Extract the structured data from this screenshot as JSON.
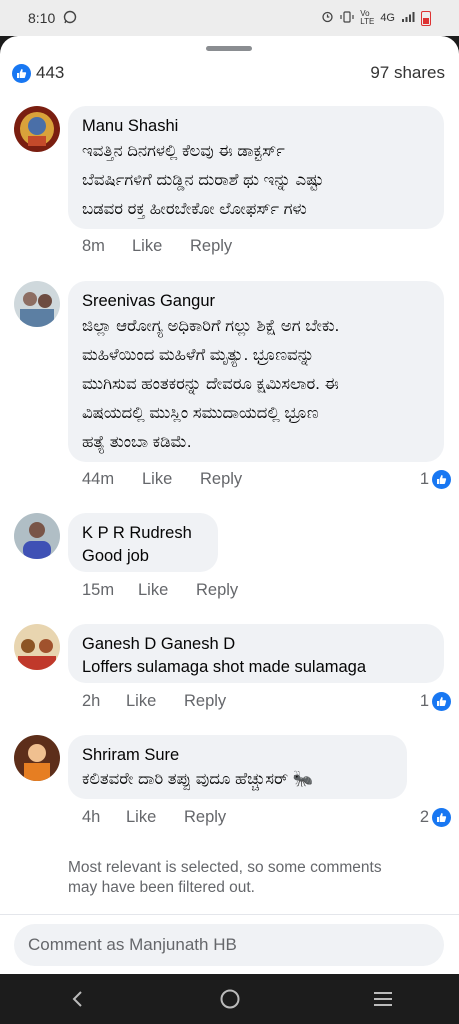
{
  "status_bar": {
    "time": "8:10",
    "network": "4G"
  },
  "post": {
    "likes_count": "443",
    "shares": "97 shares"
  },
  "comments": [
    {
      "author": "Manu Shashi",
      "lines": [
        "ಇವತ್ತಿನ ದಿನಗಳಲ್ಲಿ ಕೆಲವು ಈ ಡಾಕ್ಟರ್ಸ್",
        "ಬೆವರ್ಷಿಗಳಿಗೆ ದುಡ್ಡಿನ ದುರಾಶೆ ಥು ಇನ್ನು ಎಷ್ಟು",
        "ಬಡವರ ರಕ್ತ ಹೀರಬೇಕೋ ಲೋಫರ್ಸ್ ಗಳು"
      ],
      "time": "8m",
      "like_label": "Like",
      "reply_label": "Reply",
      "reactions": ""
    },
    {
      "author": "Sreenivas Gangur",
      "lines": [
        "ಜಿಲ್ಲಾ ಆರೋಗ್ಯ ಅಧಿಕಾರಿಗೆ ಗಲ್ಲು ಶಿಕ್ಷೆ ಅಗ ಬೇಕು.",
        "ಮಹಿಳೆಯಿಂದ ಮಹಿಳೆಗೆ ಮೃತ್ಯು. ಭ್ರೂಣವನ್ನು",
        "ಮುಗಿಸುವ ಹಂತಕರನ್ನು ದೇವರೂ ಕ್ಷಮಿಸಲಾರ. ಈ",
        "ವಿಷಯದಲ್ಲಿ ಮುಸ್ಲಿಂ ಸಮುದಾಯದಲ್ಲಿ ಭ್ರೂಣ",
        "ಹತ್ಯೆ ತುಂಬಾ ಕಡಿಮೆ."
      ],
      "time": "44m",
      "like_label": "Like",
      "reply_label": "Reply",
      "reactions": "1"
    },
    {
      "author": "K P R Rudresh",
      "lines": [
        "Good job"
      ],
      "time": "15m",
      "like_label": "Like",
      "reply_label": "Reply",
      "reactions": ""
    },
    {
      "author": "Ganesh D Ganesh D",
      "lines": [
        "Loffers sulamaga shot made sulamaga"
      ],
      "time": "2h",
      "like_label": "Like",
      "reply_label": "Reply",
      "reactions": "1"
    },
    {
      "author": "Shriram Sure",
      "lines": [
        "ಕಲಿತವರೇ ದಾರಿ ತಪ್ಪು ವುದೂ ಹೆಚ್ಚುಸರ್ 🐜"
      ],
      "time": "4h",
      "like_label": "Like",
      "reply_label": "Reply",
      "reactions": "2"
    }
  ],
  "footnote": "Most relevant is selected, so some comments may have been filtered out.",
  "composer": {
    "placeholder": "Comment as Manjunath HB"
  },
  "colors": {
    "accent": "#1877f2",
    "bubble": "#f0f2f5",
    "muted": "#65676b"
  }
}
